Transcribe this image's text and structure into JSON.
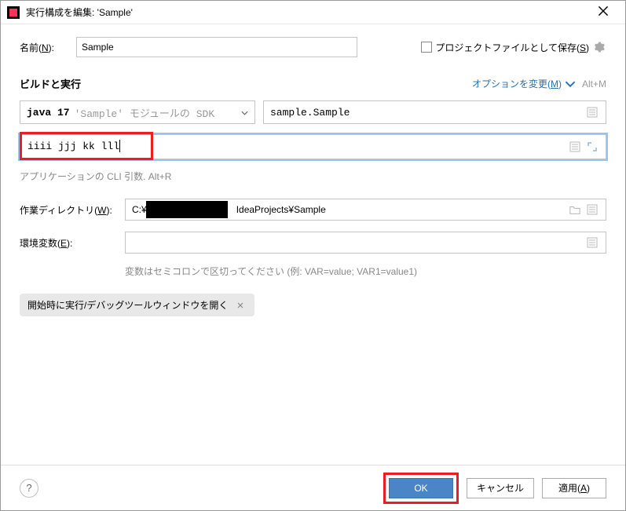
{
  "title_bar": {
    "title": "実行構成を編集: 'Sample'"
  },
  "name": {
    "label_pre": "名前(",
    "label_u": "N",
    "label_post": "):",
    "value": "Sample"
  },
  "save_project": {
    "label_pre": "プロジェクトファイルとして保存(",
    "label_u": "S",
    "label_post": ")"
  },
  "build": {
    "section_title": "ビルドと実行",
    "change_options_pre": "オプションを変更(",
    "change_options_u": "M",
    "change_options_post": ")",
    "change_options_hint": "Alt+M",
    "sdk_version": "java 17",
    "sdk_module": "'Sample' モジュールの SDK",
    "main_class": "sample.Sample"
  },
  "cli": {
    "value": "iiii jjj kk lll",
    "hint": "アプリケーションの CLI 引数. Alt+R"
  },
  "workdir": {
    "label_pre": "作業ディレクトリ(",
    "label_u": "W",
    "label_post": "):",
    "pre_text": "C:¥",
    "post_text": "IdeaProjects¥Sample"
  },
  "env": {
    "label_pre": "環境変数(",
    "label_u": "E",
    "label_post": "):",
    "hint": "変数はセミコロンで区切ってください (例: VAR=value; VAR1=value1)"
  },
  "tag": {
    "label": "開始時に実行/デバッグツールウィンドウを開く"
  },
  "footer": {
    "ok": "OK",
    "cancel": "キャンセル",
    "apply_pre": "適用(",
    "apply_u": "A",
    "apply_post": ")"
  }
}
